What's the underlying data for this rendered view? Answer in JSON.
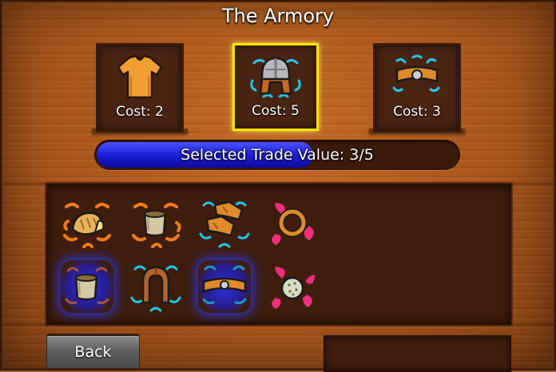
{
  "title": "The Armory",
  "offers": [
    {
      "name": "tunic-icon",
      "cost_label": "Cost: 2",
      "selected": false
    },
    {
      "name": "helmet-icon",
      "cost_label": "Cost: 5",
      "selected": true
    },
    {
      "name": "belt-icon",
      "cost_label": "Cost: 3",
      "selected": false
    }
  ],
  "trade": {
    "label": "Selected Trade Value: 3/5",
    "current": 3,
    "target": 5
  },
  "inventory": [
    {
      "icon": "bread-icon",
      "aura": "orange",
      "selected": false
    },
    {
      "icon": "mug-icon",
      "aura": "orange",
      "selected": false
    },
    {
      "icon": "boots-icon",
      "aura": "cyan",
      "selected": false
    },
    {
      "icon": "ring-icon",
      "aura": "pink",
      "selected": false
    },
    {
      "icon": "mug-icon",
      "aura": "orange",
      "selected": true
    },
    {
      "icon": "hood-icon",
      "aura": "cyan",
      "selected": false
    },
    {
      "icon": "belt-icon",
      "aura": "cyan",
      "selected": true
    },
    {
      "icon": "orb-icon",
      "aura": "pink",
      "selected": false
    }
  ],
  "buttons": {
    "back_label": "Back"
  },
  "colors": {
    "selection_border": "#f6e400",
    "progress_fill": "#1d20d8",
    "cyan_aura": "#1ec8e6",
    "orange_aura": "#f07a1e",
    "pink_aura": "#ee2f7c"
  }
}
